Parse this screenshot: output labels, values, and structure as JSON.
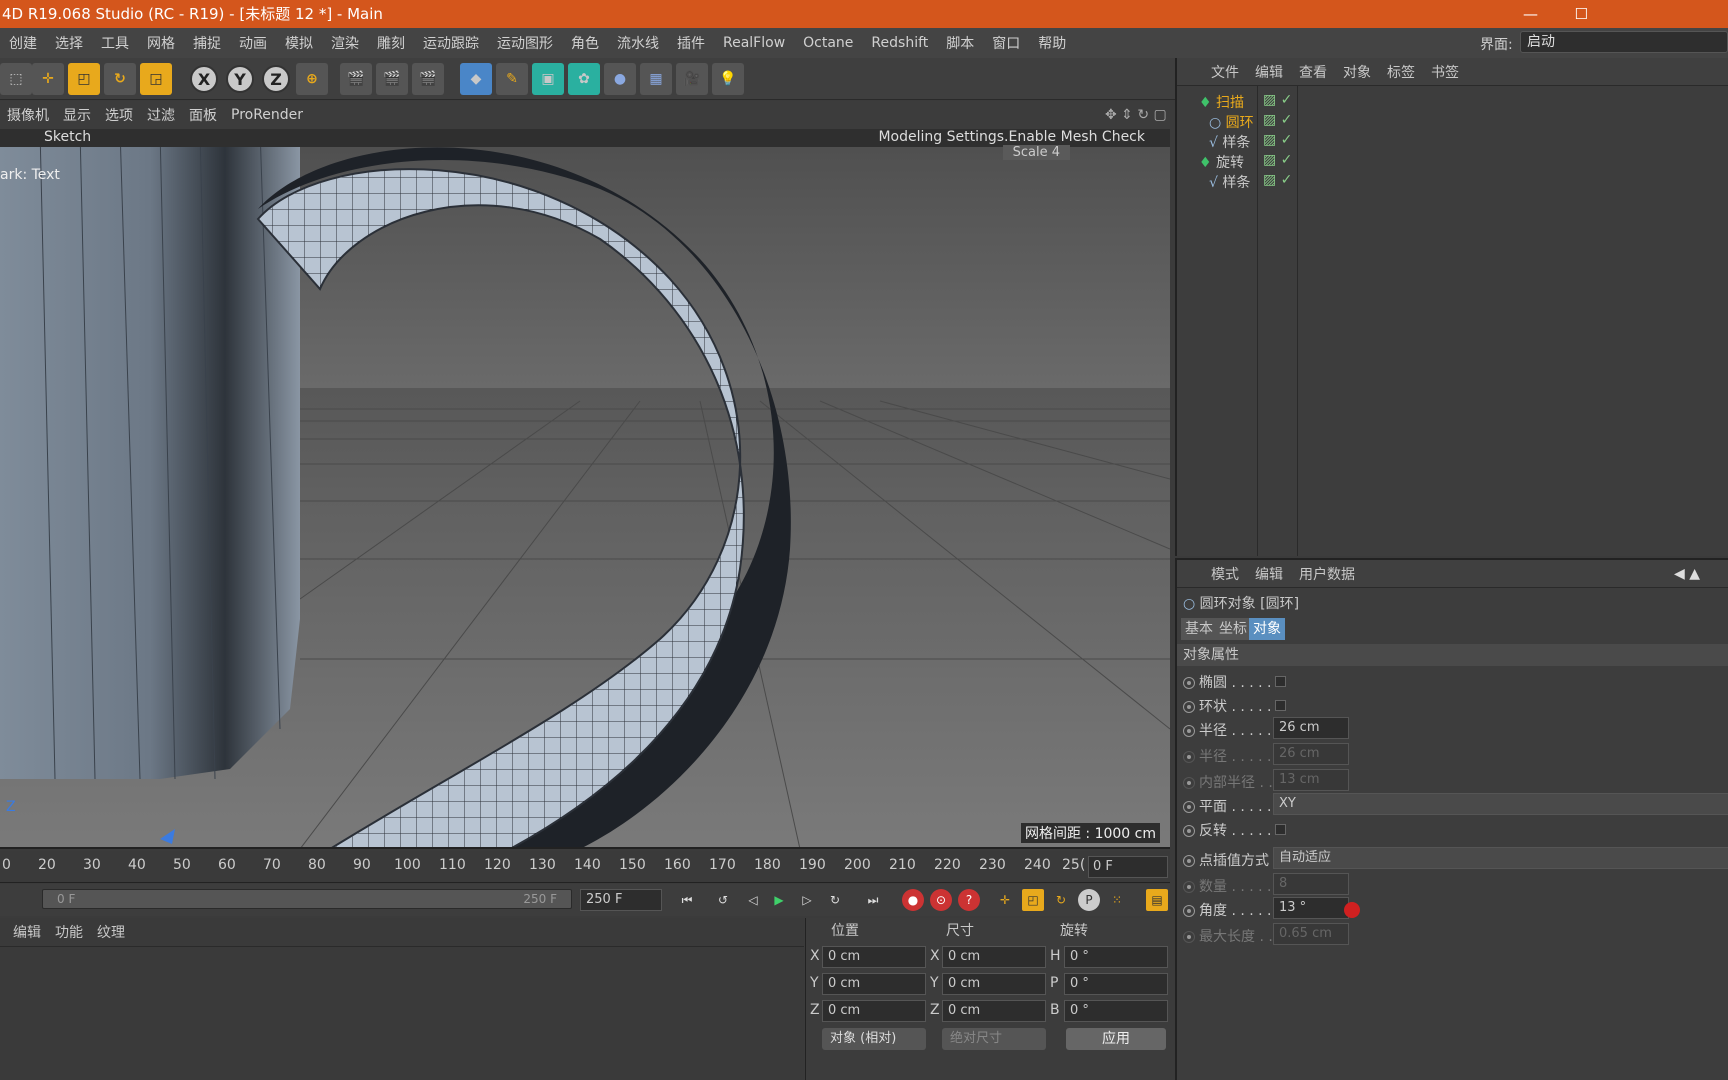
{
  "window": {
    "title": "4D R19.068 Studio (RC - R19) - [未标题 12 *] - Main",
    "min": "—",
    "max": "☐"
  },
  "menu": {
    "items": [
      "创建",
      "选择",
      "工具",
      "网格",
      "捕捉",
      "动画",
      "模拟",
      "渲染",
      "雕刻",
      "运动跟踪",
      "运动图形",
      "角色",
      "流水线",
      "插件",
      "RealFlow",
      "Octane",
      "Redshift",
      "脚本",
      "窗口",
      "帮助"
    ],
    "ui_label": "界面:",
    "ui_value": "启动"
  },
  "toolbar": {
    "x": "X",
    "y": "Y",
    "z": "Z"
  },
  "viewport": {
    "menu": [
      "摄像机",
      "显示",
      "选项",
      "过滤",
      "面板",
      "ProRender"
    ],
    "tab_label": "Sketch",
    "overlay_text": "Modeling Settings.Enable Mesh Check",
    "overlay_scale": "Scale 4",
    "left_text": "ark: Text",
    "axis_label": "Z",
    "grid_label": "网格间距 : 1000 cm"
  },
  "timeline": {
    "ticks": [
      "0",
      "20",
      "30",
      "40",
      "50",
      "60",
      "70",
      "80",
      "90",
      "100",
      "110",
      "120",
      "130",
      "140",
      "150",
      "160",
      "170",
      "180",
      "190",
      "200",
      "210",
      "220",
      "230",
      "240",
      "25("
    ],
    "frame": "0 F",
    "slider_start": "0 F",
    "slider_end": "250 F",
    "end_field": "250 F"
  },
  "bottom_left": {
    "tabs": [
      "编辑",
      "功能",
      "纹理"
    ]
  },
  "coords": {
    "hdr_pos": "位置",
    "hdr_size": "尺寸",
    "hdr_rot": "旋转",
    "x_pos": "0 cm",
    "y_pos": "0 cm",
    "z_pos": "0 cm",
    "x_size": "0 cm",
    "y_size": "0 cm",
    "z_size": "0 cm",
    "h": "0 °",
    "p": "0 °",
    "b": "0 °",
    "mode1": "对象 (相对)",
    "mode2": "绝对尺寸",
    "apply": "应用",
    "lx": "X",
    "ly": "Y",
    "lz": "Z",
    "lh": "H",
    "lp": "P",
    "lb": "B"
  },
  "object_manager": {
    "menu": [
      "文件",
      "编辑",
      "查看",
      "对象",
      "标签",
      "书签"
    ],
    "objects": [
      {
        "name": "扫描",
        "color": "#e8a91c"
      },
      {
        "name": "圆环",
        "color": "#e8a91c"
      },
      {
        "name": "样条",
        "color": "#cccccc"
      },
      {
        "name": "旋转",
        "color": "#cccccc"
      },
      {
        "name": "样条",
        "color": "#cccccc"
      }
    ]
  },
  "attributes": {
    "menu": [
      "模式",
      "编辑",
      "用户数据"
    ],
    "object_title": "圆环对象 [圆环]",
    "tabs": [
      "基本",
      "坐标",
      "对象"
    ],
    "section": "对象属性",
    "ellipse": "椭圆 . . . . . .",
    "ring": "环状 . . . . . .",
    "radius_label": "半径 . . . . . .",
    "radius": "26 cm",
    "radius2_label": "半径 . . . . . .",
    "radius2": "26 cm",
    "inner_label": "内部半径 . .",
    "inner": "13 cm",
    "plane_label": "平面 . . . . . .",
    "plane": "XY",
    "reverse": "反转 . . . . . .",
    "interp_label": "点插值方式",
    "interp": "自动适应",
    "count_label": "数量 . . . . . .",
    "count": "8",
    "angle_label": "角度 . . . . . .",
    "angle": "13 °",
    "maxlen_label": "最大长度 . .",
    "maxlen": "0.65 cm"
  }
}
